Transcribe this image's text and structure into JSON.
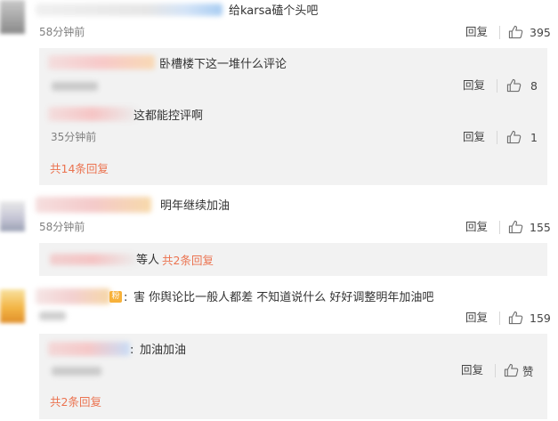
{
  "comments": [
    {
      "text": "给karsa磕个头吧",
      "time": "58分钟前",
      "reply_label": "回复",
      "likes": "395",
      "replies": [
        {
          "text": "卧槽楼下这一堆什么评论",
          "reply_label": "回复",
          "likes": "8"
        },
        {
          "text": "这都能控评啊",
          "time": "35分钟前",
          "reply_label": "回复",
          "likes": "1"
        }
      ],
      "more_label": "共14条回复"
    },
    {
      "text": "明年继续加油",
      "time": "58分钟前",
      "reply_label": "回复",
      "likes": "155",
      "reply_summary_suffix": "等人",
      "more_label": "共2条回复"
    },
    {
      "text": "害 你舆论比一般人都差 不知道说什么 好好调整明年加油吧",
      "reply_label": "回复",
      "likes": "159",
      "replies": [
        {
          "text": "加油加油",
          "reply_label": "回复",
          "likes": "赞"
        }
      ],
      "more_label": "共2条回复"
    }
  ],
  "colors": {
    "link": "#eb7350",
    "sub_bg": "#f2f2f2",
    "text": "#333333",
    "muted": "#808080"
  },
  "icons": {
    "like": "thumbs-up-icon",
    "fan_badge": "fan-badge-icon"
  }
}
